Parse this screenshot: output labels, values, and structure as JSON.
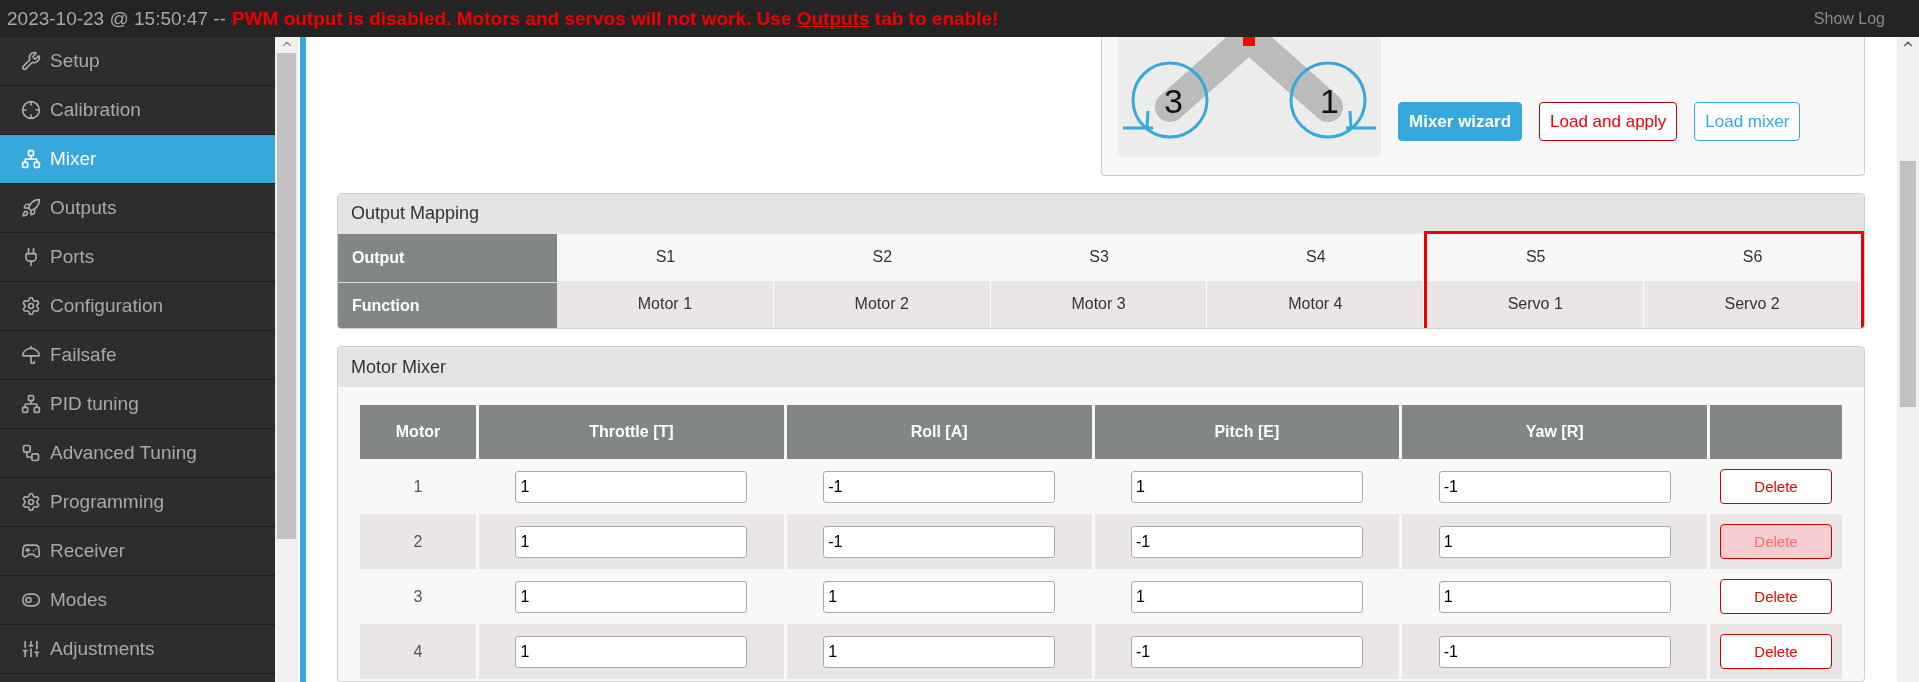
{
  "status_bar": {
    "timestamp": "2023-10-23 @ 15:50:47 --",
    "message_before": "PWM output is disabled. Motors and servos will not work. Use",
    "message_link": "Outputs",
    "message_after": "tab to enable!",
    "show_log": "Show Log"
  },
  "sidebar": {
    "items": [
      {
        "label": "Setup",
        "selected": false
      },
      {
        "label": "Calibration",
        "selected": false
      },
      {
        "label": "Mixer",
        "selected": true
      },
      {
        "label": "Outputs",
        "selected": false
      },
      {
        "label": "Ports",
        "selected": false
      },
      {
        "label": "Configuration",
        "selected": false
      },
      {
        "label": "Failsafe",
        "selected": false
      },
      {
        "label": "PID tuning",
        "selected": false
      },
      {
        "label": "Advanced Tuning",
        "selected": false
      },
      {
        "label": "Programming",
        "selected": false
      },
      {
        "label": "Receiver",
        "selected": false
      },
      {
        "label": "Modes",
        "selected": false
      },
      {
        "label": "Adjustments",
        "selected": false
      }
    ]
  },
  "mixer_preview": {
    "motor_labels": [
      "3",
      "1"
    ],
    "buttons": [
      {
        "label": "Mixer wizard",
        "kind": "primary"
      },
      {
        "label": "Load and apply",
        "kind": "danger"
      },
      {
        "label": "Load mixer",
        "kind": "outline"
      }
    ]
  },
  "output_mapping": {
    "title": "Output Mapping",
    "row_labels": [
      "Output",
      "Function"
    ],
    "columns": [
      {
        "output": "S1",
        "function": "Motor 1",
        "highlighted": false
      },
      {
        "output": "S2",
        "function": "Motor 2",
        "highlighted": false
      },
      {
        "output": "S3",
        "function": "Motor 3",
        "highlighted": false
      },
      {
        "output": "S4",
        "function": "Motor 4",
        "highlighted": false
      },
      {
        "output": "S5",
        "function": "Servo 1",
        "highlighted": true
      },
      {
        "output": "S6",
        "function": "Servo 2",
        "highlighted": true
      }
    ]
  },
  "motor_mixer": {
    "title": "Motor Mixer",
    "columns": [
      "Motor",
      "Throttle [T]",
      "Roll [A]",
      "Pitch [E]",
      "Yaw [R]"
    ],
    "rows": [
      {
        "motor": "1",
        "values": [
          "1",
          "-1",
          "1",
          "-1"
        ],
        "delete": "Delete",
        "hovered": false
      },
      {
        "motor": "2",
        "values": [
          "1",
          "-1",
          "-1",
          "1"
        ],
        "delete": "Delete",
        "hovered": true
      },
      {
        "motor": "3",
        "values": [
          "1",
          "1",
          "1",
          "1"
        ],
        "delete": "Delete",
        "hovered": false
      },
      {
        "motor": "4",
        "values": [
          "1",
          "1",
          "-1",
          "-1"
        ],
        "delete": "Delete",
        "hovered": false
      }
    ]
  }
}
